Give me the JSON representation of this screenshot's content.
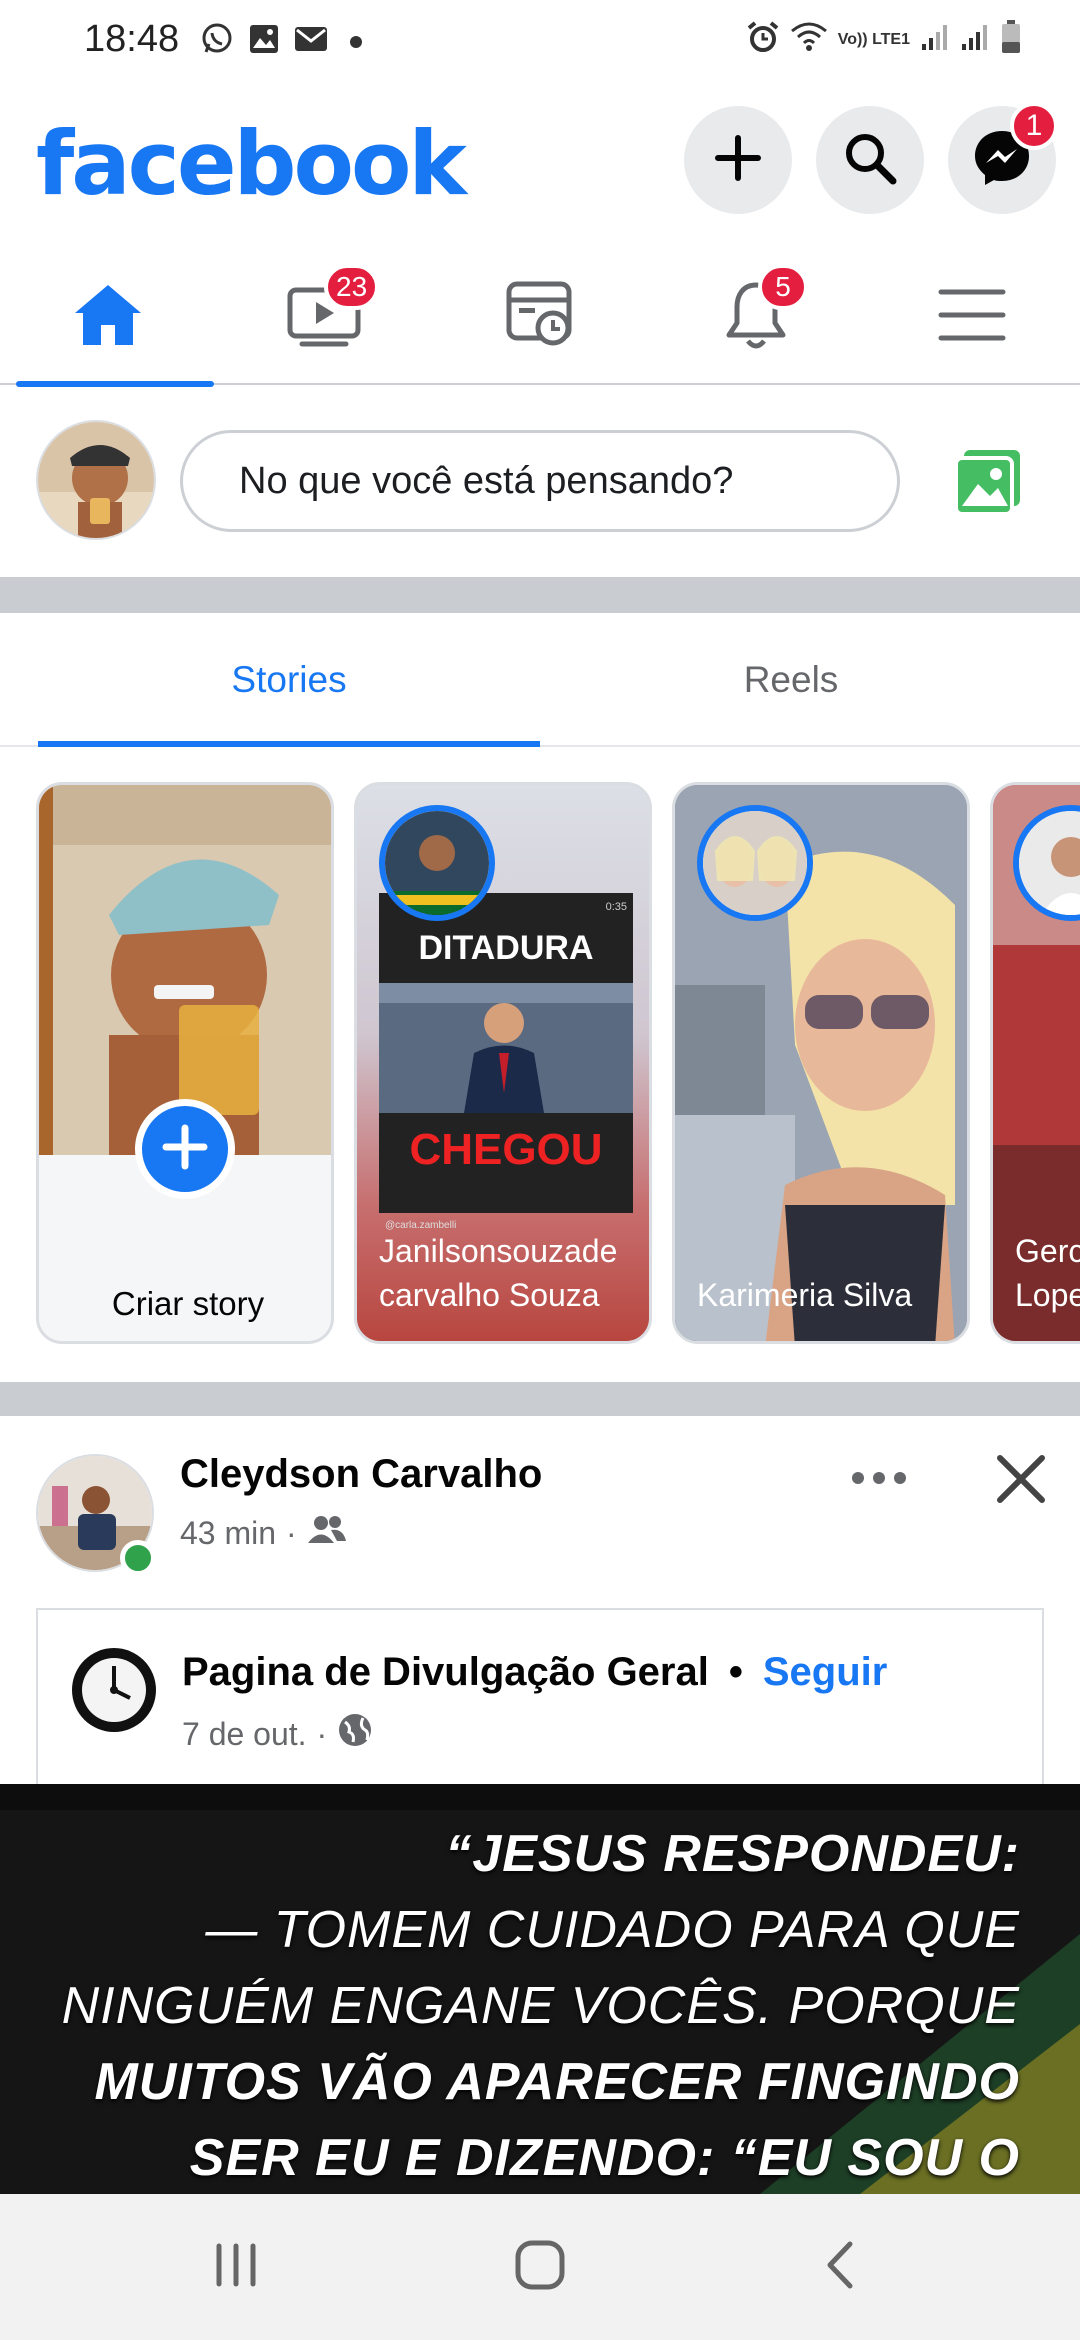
{
  "status_bar": {
    "time": "18:48",
    "left_icons": [
      "whatsapp-icon",
      "gallery-icon",
      "mail-icon",
      "dot-icon"
    ],
    "lte_label": "Vo)) LTE1",
    "right_icons": [
      "alarm-icon",
      "wifi-icon",
      "signal-icon",
      "signal-icon",
      "battery-icon"
    ]
  },
  "header": {
    "logo": "facebook",
    "messenger_badge": "1",
    "brand_color": "#1877f2"
  },
  "nav": {
    "watch_badge": "23",
    "notifications_badge": "5",
    "active": "home"
  },
  "composer": {
    "placeholder": "No que você está pensando?"
  },
  "stories_tabs": {
    "stories": "Stories",
    "reels": "Reels"
  },
  "stories": {
    "create_label": "Criar story",
    "items": [
      {
        "name_line1": "Janilsonsouzade",
        "name_line2": "carvalho Souza",
        "headline_top": "DITADURA",
        "headline_bottom": "CHEGOU",
        "tag": "@carla.zambelli",
        "duration": "0:35"
      },
      {
        "name_line1": "Karimeria Silva",
        "name_line2": ""
      },
      {
        "name_line1": "Gerc",
        "name_line2": "Lope"
      }
    ]
  },
  "post": {
    "author": "Cleydson Carvalho",
    "time": "43 min",
    "shared": {
      "page_name": "Pagina de Divulgação Geral",
      "separator": "•",
      "follow_label": "Seguir",
      "date": "7 de out.",
      "separator_meta": "·"
    },
    "image_text": [
      "“JESUS RESPONDEU:",
      "— TOMEM CUIDADO PARA QUE",
      "NINGUÉM ENGANE VOCÊS. PORQUE",
      "MUITOS VÃO APARECER FINGINDO",
      "SER EU E DIZENDO: “EU SOU O"
    ]
  },
  "android_nav": [
    "recents-icon",
    "home-icon",
    "back-icon"
  ]
}
